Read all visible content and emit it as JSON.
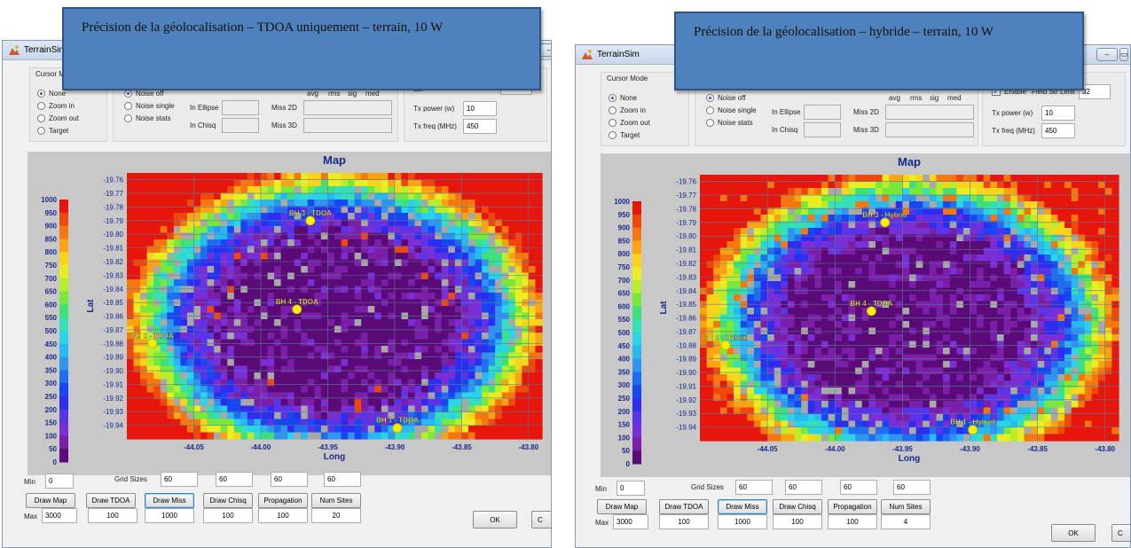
{
  "app": {
    "title": "TerrainSim"
  },
  "window_buttons": {
    "minimize": "–",
    "maximize": "▭"
  },
  "cursor_mode": {
    "title_left": "Cursor Mo",
    "title_right": "Cursor Mode",
    "options": [
      "None",
      "Zoom in",
      "Zoom out",
      "Target"
    ],
    "selected": "None"
  },
  "noise": {
    "options": [
      "Noise off",
      "Noise single",
      "Noise stats"
    ],
    "selected": "Noise off"
  },
  "stats": {
    "in_ellipse": "In Ellipse",
    "in_chisq": "In Chisq",
    "miss_2d": "Miss 2D",
    "miss_3d": "Miss 3D",
    "headers": [
      "avg",
      "rms",
      "sig",
      "med"
    ]
  },
  "field": {
    "enable_label": "Enable",
    "enable_checked": true,
    "fsl_label": "Field Str Limit",
    "fsl_value": "32",
    "txp_label": "Tx power (w)",
    "txp_value": "10",
    "txf_label": "Tx freq (MHz)",
    "txf_value": "450"
  },
  "map": {
    "title": "Map",
    "xlabel": "Long",
    "ylabel": "Lat",
    "lat_ticks": [
      "-19.76",
      "-19.77",
      "-19.78",
      "-19.79",
      "-19.80",
      "-19.81",
      "-19.82",
      "-19.83",
      "-19.84",
      "-19.85",
      "-19.86",
      "-19.87",
      "-19.88",
      "-19.89",
      "-19.90",
      "-19.91",
      "-19.92",
      "-19.93",
      "-19.94"
    ],
    "long_ticks": [
      "-44.05",
      "-44.00",
      "-43.95",
      "-43.90",
      "-43.85",
      "-43.80"
    ],
    "colorbar_ticks": [
      "1000",
      "950",
      "900",
      "850",
      "800",
      "750",
      "700",
      "650",
      "600",
      "550",
      "500",
      "450",
      "400",
      "350",
      "300",
      "250",
      "200",
      "150",
      "100",
      "50",
      "0"
    ]
  },
  "sites_left": [
    {
      "label": "BH 3 - TDOA",
      "lon": -43.963,
      "lat": -19.79
    },
    {
      "label": "BH 4 - TDOA",
      "lon": -43.973,
      "lat": -19.855
    },
    {
      "label": "BH 2 - TDOA",
      "lon": -44.081,
      "lat": -19.88
    },
    {
      "label": "BH 1 - TDOA",
      "lon": -43.898,
      "lat": -19.942
    }
  ],
  "sites_right": [
    {
      "label": "BH 3 - Hybrid",
      "lon": -43.963,
      "lat": -19.79
    },
    {
      "label": "BH 4 - TDOA",
      "lon": -43.973,
      "lat": -19.855
    },
    {
      "label": "BH 2 - Hybrid",
      "lon": -44.081,
      "lat": -19.88
    },
    {
      "label": "BH 1 - Hybrid",
      "lon": -43.898,
      "lat": -19.942
    }
  ],
  "controls": {
    "min_label": "Min",
    "min_value": "0",
    "max_label": "Max",
    "max_value": "3000",
    "grid_label": "Grid Sizes",
    "grid_values": [
      "60",
      "60",
      "60",
      "60"
    ],
    "buttons": [
      "Draw Map",
      "Draw TDOA",
      "Draw Miss",
      "Draw Chisq",
      "Propagation",
      "Num Sites"
    ],
    "row_values": [
      "100",
      "1000",
      "100",
      "100"
    ],
    "num_sites_left": "20",
    "num_sites_right": "4",
    "ok": "OK",
    "cancel_partial": "C"
  },
  "callouts": {
    "left": "Précision de la géolocalisation – TDOA uniquement – terrain, 10 W",
    "right": "Précision de la géolocalisation – hybride – terrain, 10 W"
  }
}
